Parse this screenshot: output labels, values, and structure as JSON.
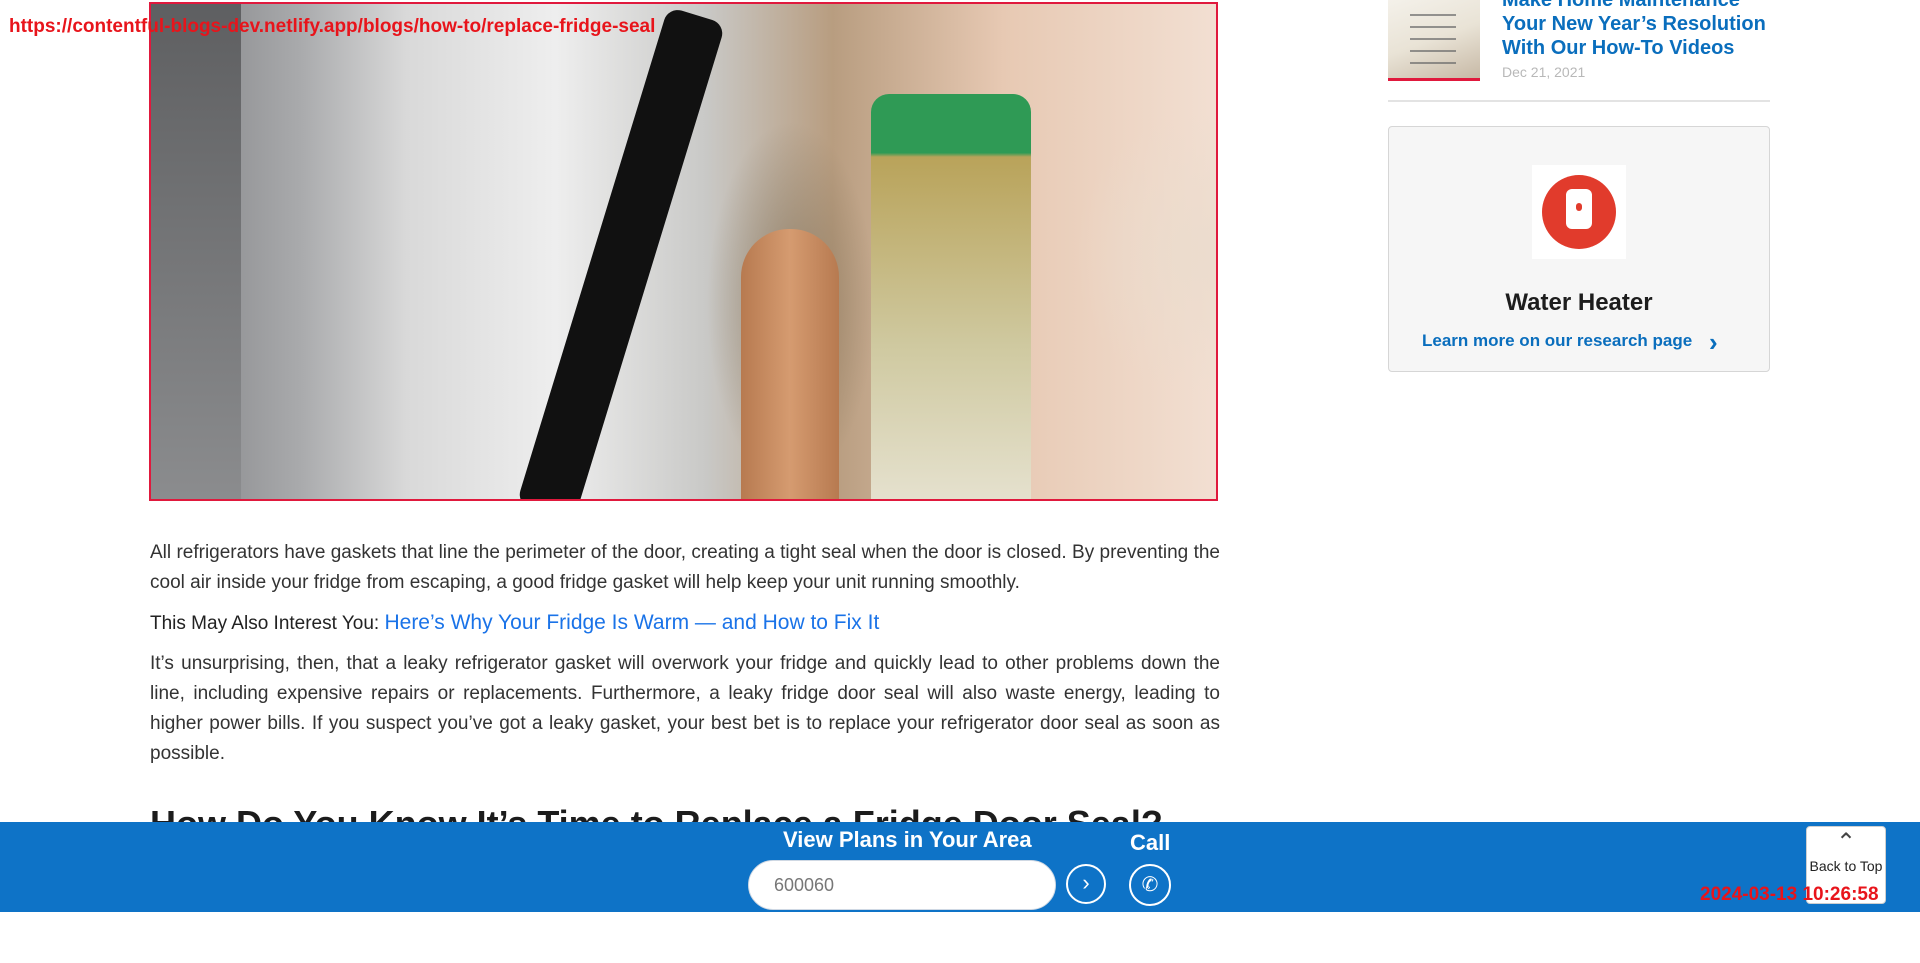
{
  "overlay": {
    "url": "https://contentful-blogs-dev.netlify.app/blogs/how-to/replace-fridge-seal",
    "timestamp": "2024-03-13 10:26:58"
  },
  "article": {
    "para1": "All refrigerators have gaskets that line the perimeter of the door, creating a tight seal when the door is closed. By preventing the cool air inside your fridge from escaping, a good fridge gasket will help keep your unit running smoothly.",
    "interest_label": "This May Also Interest You: ",
    "interest_link": "Here’s Why Your Fridge Is Warm — and How to Fix It",
    "para2": "It’s unsurprising, then, that a leaky refrigerator gasket will overwork your fridge and quickly lead to other problems down the line, including expensive repairs or replacements. Furthermore, a leaky fridge door seal will also waste energy, leading to higher power bills. If you suspect you’ve got a leaky gasket, your best bet is to replace your refrigerator door seal as soon as possible.",
    "heading": "How Do You Know It’s Time to Replace a Fridge Door Seal?"
  },
  "sidebar": {
    "related_title": "Make Home Maintenance Your New Year’s Resolution With Our How-To Videos",
    "related_date": "Dec 21, 2021",
    "card_title": "Water Heater",
    "card_link": "Learn more on our research page",
    "card_icon": "water-heater-icon"
  },
  "bottom_bar": {
    "title": "View Plans in Your Area",
    "zip_value": "600060",
    "call_label": "Call"
  },
  "back_to_top": {
    "label": "Back to Top"
  },
  "colors": {
    "accent_blue": "#0e73c7",
    "link_blue": "#1a73e8",
    "overlay_red": "#e8141b",
    "card_icon_red": "#e13b2c"
  }
}
